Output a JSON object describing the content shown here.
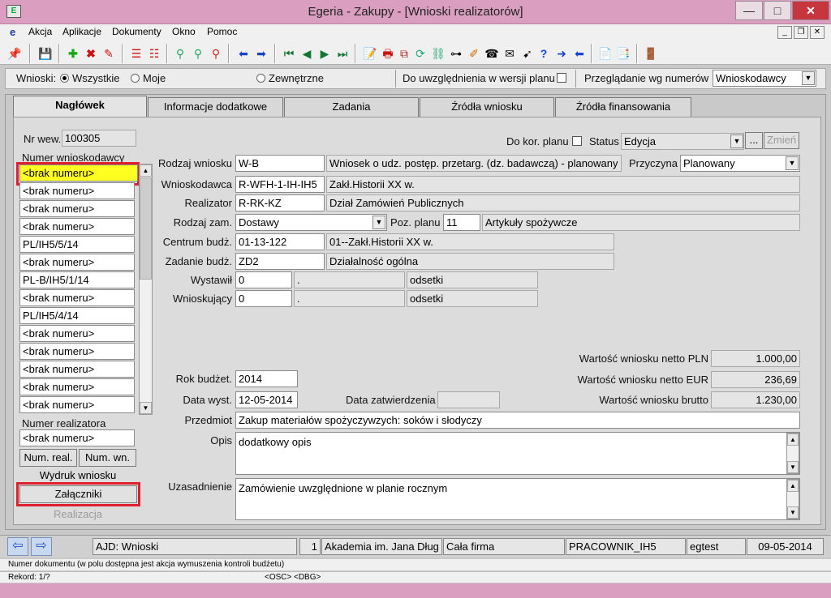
{
  "window": {
    "title": "Egeria - Zakupy - [Wnioski realizatorów]"
  },
  "menu": [
    "Akcja",
    "Aplikacje",
    "Dokumenty",
    "Okno",
    "Pomoc"
  ],
  "filters": {
    "label": "Wnioski:",
    "opt_all": "Wszystkie",
    "opt_mine": "Moje",
    "opt_external": "Zewnętrzne",
    "plan_version": "Do uwzględnienia w wersji planu",
    "browse_by": "Przeglądanie wg numerów",
    "browse_value": "Wnioskodawcy"
  },
  "tabs": [
    "Nagłówek",
    "Informacje dodatkowe",
    "Zadania",
    "Źródła wniosku",
    "Źródła finansowania"
  ],
  "left": {
    "nr_wew_label": "Nr wew.",
    "nr_wew": "100305",
    "applicant_no_label": "Numer wnioskodawcy",
    "applicant_numbers": [
      "<brak numeru>",
      "<brak numeru>",
      "<brak numeru>",
      "<brak numeru>",
      "PL/IH5/5/14",
      "<brak numeru>",
      "PL-B/IH5/1/14",
      "<brak numeru>",
      "PL/IH5/4/14",
      "<brak numeru>",
      "<brak numeru>",
      "<brak numeru>",
      "<brak numeru>",
      "<brak numeru>"
    ],
    "realizer_no_label": "Numer realizatora",
    "realizer_no": "<brak numeru>",
    "btn_num_real": "Num. real.",
    "btn_num_wn": "Num. wn.",
    "btn_print": "Wydruk wniosku",
    "btn_attachments": "Załączniki",
    "btn_realization": "Realizacja"
  },
  "form": {
    "do_kor_label": "Do kor. planu",
    "status_label": "Status",
    "status": "Edycja",
    "dots": "...",
    "zmien": "Zmień",
    "rodzaj_label": "Rodzaj wniosku",
    "rodzaj_code": "W-B",
    "rodzaj_desc": "Wniosek o udz. postęp. przetarg. (dz. badawczą) - planowany",
    "przyczyna_label": "Przyczyna",
    "przyczyna": "Planowany",
    "wnioskodawca_label": "Wnioskodawca",
    "wnioskodawca_code": "R-WFH-1-IH-IH5",
    "wnioskodawca_desc": "Zakł.Historii XX w.",
    "realizator_label": "Realizator",
    "realizator_code": "R-RK-KZ",
    "realizator_desc": "Dział Zamówień Publicznych",
    "rodzaj_zam_label": "Rodzaj zam.",
    "rodzaj_zam": "Dostawy",
    "poz_planu_label": "Poz. planu",
    "poz_planu": "11",
    "poz_planu_desc": "Artykuły spożywcze",
    "centrum_label": "Centrum budż.",
    "centrum_code": "01-13-122",
    "centrum_desc": "01--Zakł.Historii XX w.",
    "zadanie_label": "Zadanie budż.",
    "zadanie_code": "ZD2",
    "zadanie_desc": "Działalność ogólna",
    "wystawil_label": "Wystawił",
    "wystawil_code": "0",
    "wystawil_dot": ".",
    "wystawil_desc": "odsetki",
    "wnioskujacy_label": "Wnioskujący",
    "wnioskujacy_code": "0",
    "wnioskujacy_dot": ".",
    "wnioskujacy_desc": "odsetki",
    "netto_pln_label": "Wartość wniosku netto PLN",
    "netto_pln": "1.000,00",
    "netto_eur_label": "Wartość wniosku netto EUR",
    "netto_eur": "236,69",
    "brutto_label": "Wartość wniosku brutto",
    "brutto": "1.230,00",
    "rok_label": "Rok budżet.",
    "rok": "2014",
    "data_wyst_label": "Data wyst.",
    "data_wyst": "12-05-2014",
    "data_zatw_label": "Data zatwierdzenia",
    "data_zatw": "",
    "przedmiot_label": "Przedmiot",
    "przedmiot": "Zakup materiałów spożyczywzych: soków i słodyczy",
    "opis_label": "Opis",
    "opis": "dodatkowy opis",
    "uzasadnienie_label": "Uzasadnienie",
    "uzasadnienie": "Zamówienie uwzględnione w planie rocznym"
  },
  "status": {
    "ajd": "AJD: Wnioski",
    "num": "1",
    "org": "Akademia im. Jana Dług",
    "scope": "Cała firma",
    "user": "PRACOWNIK_IH5",
    "db": "egtest",
    "date": "09-05-2014",
    "hint": "Numer dokumentu (w polu dostępna jest akcja wymuszenia  kontroli budżetu)",
    "rekord": "Rekord: 1/?",
    "osc": "<OSC>",
    "dbg": "<DBG>"
  }
}
